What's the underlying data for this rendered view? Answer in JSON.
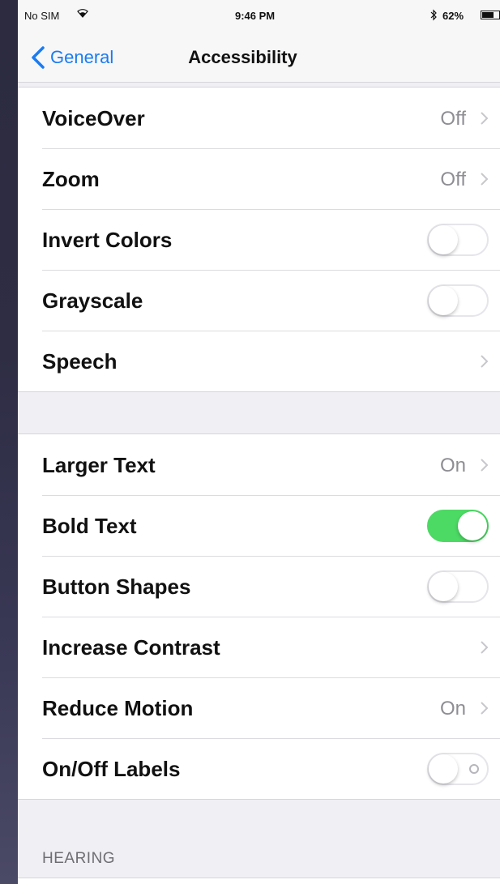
{
  "status_bar": {
    "carrier": "No SIM",
    "wifi_icon": "wifi-icon",
    "time": "9:46 PM",
    "bluetooth_icon": "bluetooth-icon",
    "battery_percent": "62%",
    "battery_level": 0.62
  },
  "nav": {
    "back_label": "General",
    "title": "Accessibility"
  },
  "group1": [
    {
      "label": "VoiceOver",
      "value": "Off",
      "type": "disclosure"
    },
    {
      "label": "Zoom",
      "value": "Off",
      "type": "disclosure"
    },
    {
      "label": "Invert Colors",
      "type": "toggle",
      "on": false
    },
    {
      "label": "Grayscale",
      "type": "toggle",
      "on": false
    },
    {
      "label": "Speech",
      "value": "",
      "type": "disclosure"
    }
  ],
  "group2": [
    {
      "label": "Larger Text",
      "value": "On",
      "type": "disclosure"
    },
    {
      "label": "Bold Text",
      "type": "toggle",
      "on": true
    },
    {
      "label": "Button Shapes",
      "type": "toggle",
      "on": false
    },
    {
      "label": "Increase Contrast",
      "value": "",
      "type": "disclosure"
    },
    {
      "label": "Reduce Motion",
      "value": "On",
      "type": "disclosure"
    },
    {
      "label": "On/Off Labels",
      "type": "toggle",
      "on": false,
      "labels_shown": true
    }
  ],
  "hearing_header": "HEARING",
  "colors": {
    "accent": "#1a7bf2",
    "toggle_on": "#4cd964",
    "value_text": "#8e8e93"
  }
}
